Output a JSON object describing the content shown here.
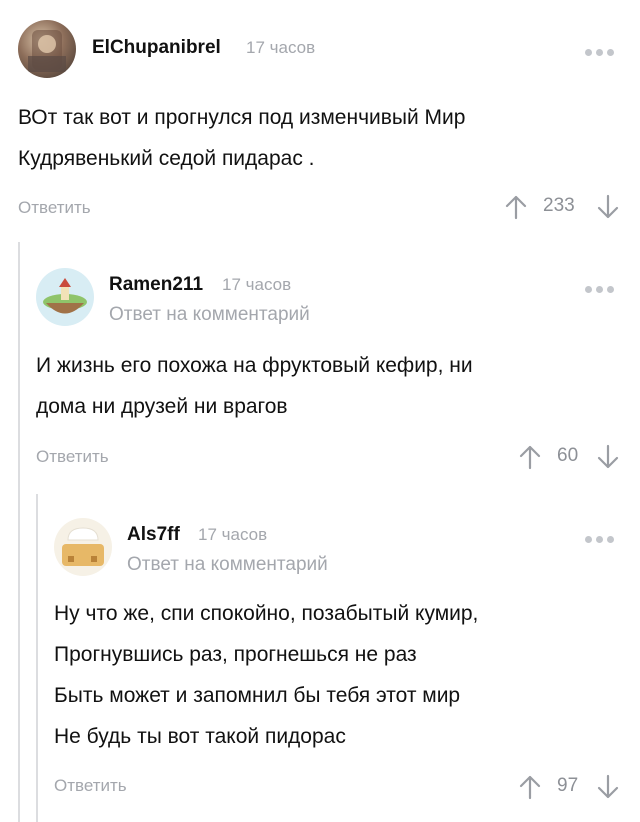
{
  "comments": [
    {
      "username": "ElChupanibrel",
      "time": "17 часов",
      "reply_prefix": "",
      "reply_target": "",
      "lines": [
        "ВОт так вот и прогнулся под изменчивый Мир",
        "Кудрявенький седой пидарас ."
      ],
      "reply_label": "Ответить",
      "votes": "233"
    },
    {
      "username": "Ramen211",
      "time": "17 часов",
      "reply_prefix": "Ответ на",
      "reply_target": "комментарий",
      "lines": [
        "И жизнь его похожа на фруктовый кефир, ни",
        "дома ни друзей ни врагов"
      ],
      "reply_label": "Ответить",
      "votes": "60"
    },
    {
      "username": "Als7ff",
      "time": "17 часов",
      "reply_prefix": "Ответ на",
      "reply_target": "комментарий",
      "lines": [
        "Ну что же, спи спокойно, позабытый кумир,",
        "Прогнувшись раз, прогнешься не раз",
        "Быть может и запомнил бы тебя этот мир",
        "Не будь ты вот такой пидорас"
      ],
      "reply_label": "Ответить",
      "votes": "97"
    }
  ],
  "icons": {
    "more": "more-dots-icon",
    "upvote": "arrow-up-icon",
    "downvote": "arrow-down-icon"
  },
  "colors": {
    "muted": "#a4a7ad",
    "text": "#111111",
    "thread_line": "#dcdde0"
  }
}
